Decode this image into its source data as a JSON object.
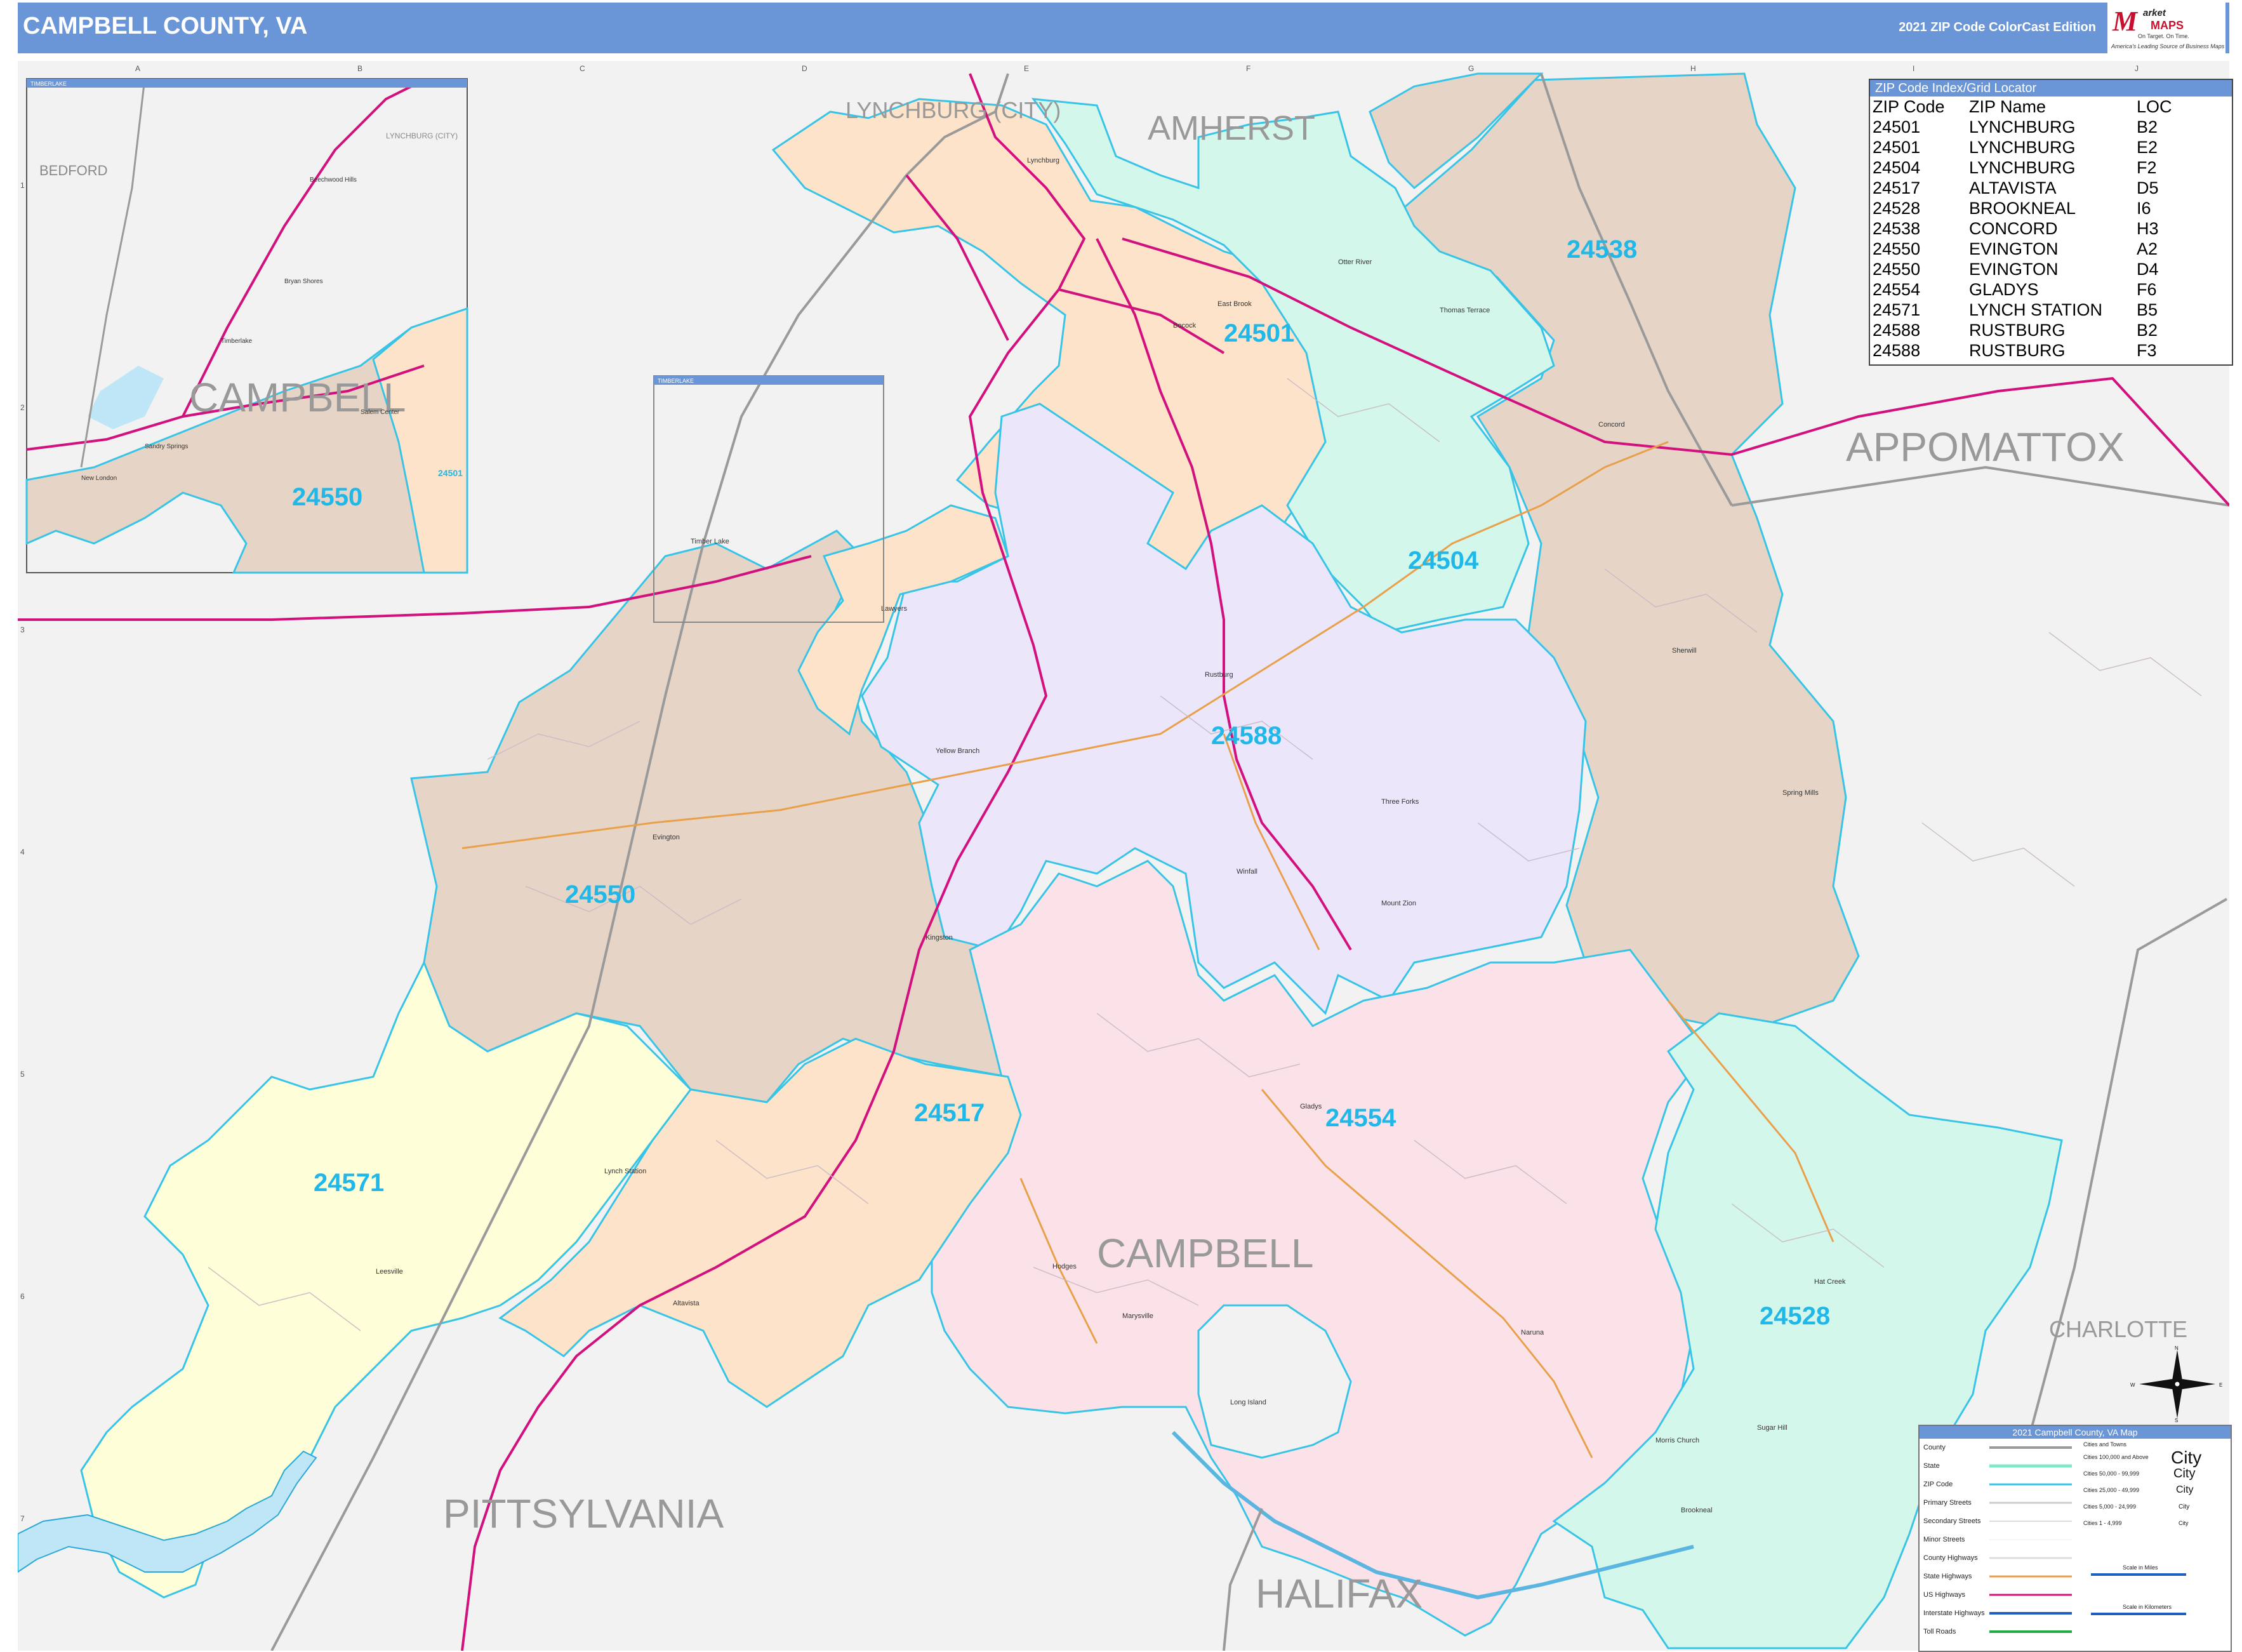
{
  "title": "CAMPBELL COUNTY, VA",
  "edition": "2021 ZIP Code ColorCast Edition",
  "logo": {
    "mark": "M",
    "name1": "arket",
    "name2": "MAPS",
    "tagline": "On Target. On Time.",
    "slogan": "America's Leading Source of Business Maps"
  },
  "colors": {
    "header": "#6a96d8",
    "zip_cyan_outline": "#38c4e6",
    "zip_label": "#1fb8e8",
    "county_line": "#9a9a9a",
    "us_highway": "#d2117e",
    "state_highway": "#e8a04a",
    "zone_peach": "#fde3c9",
    "zone_tan": "#e6d5c6",
    "zone_mint": "#d4f7ec",
    "zone_lavender": "#ece6fb",
    "zone_pink": "#fbe2e8",
    "zone_yellow": "#fefed8",
    "outside_gray": "#f2f2f2"
  },
  "grid": {
    "columns": [
      "A",
      "B",
      "C",
      "D",
      "E",
      "F",
      "G",
      "H",
      "I",
      "J"
    ],
    "rows": [
      "1",
      "2",
      "3",
      "4",
      "5",
      "6",
      "7"
    ]
  },
  "neighbors": [
    {
      "name": "LYNCHBURG (CITY)"
    },
    {
      "name": "AMHERST"
    },
    {
      "name": "APPOMATTOX"
    },
    {
      "name": "BEDFORD"
    },
    {
      "name": "PITTSYLVANIA"
    },
    {
      "name": "HALIFAX"
    },
    {
      "name": "CHARLOTTE"
    },
    {
      "name": "CAMPBELL"
    }
  ],
  "zip_labels": [
    {
      "zip": "24538"
    },
    {
      "zip": "24501"
    },
    {
      "zip": "24504"
    },
    {
      "zip": "24588"
    },
    {
      "zip": "24550"
    },
    {
      "zip": "24517"
    },
    {
      "zip": "24554"
    },
    {
      "zip": "24571"
    },
    {
      "zip": "24528"
    }
  ],
  "places": [
    "Lynchburg",
    "Timber Lake",
    "Lawyers",
    "Rustburg",
    "Concord",
    "Yellow Branch",
    "Evington",
    "Three Forks",
    "Winfall",
    "Mount Zion",
    "Kingston",
    "Gladys",
    "Lynch Station",
    "Leesville",
    "Altavista",
    "Hodges",
    "Marysville",
    "Naruna",
    "Long Island",
    "Spring Mills",
    "Sherwill",
    "Hat Creek",
    "Morris Church",
    "Brookneal",
    "Sugar Hill",
    "Thomas Terrace",
    "East Brook",
    "Bocock",
    "Otter River"
  ],
  "inset": {
    "title": "TIMBERLAKE",
    "labels": {
      "bedford": "BEDFORD",
      "lynchburg": "LYNCHBURG (CITY)",
      "campbell": "CAMPBELL",
      "zip_main": "24550",
      "zip_small": "24501"
    },
    "places": [
      "Beechwood Hills",
      "Bryan Shores",
      "Timberlake",
      "Salem Center",
      "Sandry Springs",
      "New London"
    ]
  },
  "locator_box_title": "TIMBERLAKE",
  "zip_index": {
    "title": "ZIP Code Index/Grid Locator",
    "headers": [
      "ZIP Code",
      "ZIP Name",
      "LOC"
    ],
    "rows": [
      [
        "24501",
        "LYNCHBURG",
        "B2"
      ],
      [
        "24501",
        "LYNCHBURG",
        "E2"
      ],
      [
        "24504",
        "LYNCHBURG",
        "F2"
      ],
      [
        "24517",
        "ALTAVISTA",
        "D5"
      ],
      [
        "24528",
        "BROOKNEAL",
        "I6"
      ],
      [
        "24538",
        "CONCORD",
        "H3"
      ],
      [
        "24550",
        "EVINGTON",
        "A2"
      ],
      [
        "24550",
        "EVINGTON",
        "D4"
      ],
      [
        "24554",
        "GLADYS",
        "F6"
      ],
      [
        "24571",
        "LYNCH STATION",
        "B5"
      ],
      [
        "24588",
        "RUSTBURG",
        "B2"
      ],
      [
        "24588",
        "RUSTBURG",
        "F3"
      ]
    ]
  },
  "legend": {
    "title": "2021 Campbell County, VA Map",
    "items": [
      "County",
      "State",
      "ZIP Code",
      "Primary Streets",
      "Secondary Streets",
      "Minor Streets",
      "County Highways",
      "State Highways",
      "US Highways",
      "Interstate Highways",
      "Toll Roads"
    ],
    "cities_title": "Cities and Towns",
    "city_sizes": [
      "Cities 100,000 and Above",
      "Cities 50,000 - 99,999",
      "Cities 25,000 - 49,999",
      "Cities 5,000 - 24,999",
      "Cities 1 - 4,999"
    ],
    "city_symbols": [
      "City",
      "City",
      "City",
      "City",
      "City"
    ],
    "scale_miles": "Scale in Miles",
    "scale_km": "Scale in Kilometers"
  },
  "compass": {
    "n": "N",
    "s": "S",
    "e": "E",
    "w": "W"
  }
}
